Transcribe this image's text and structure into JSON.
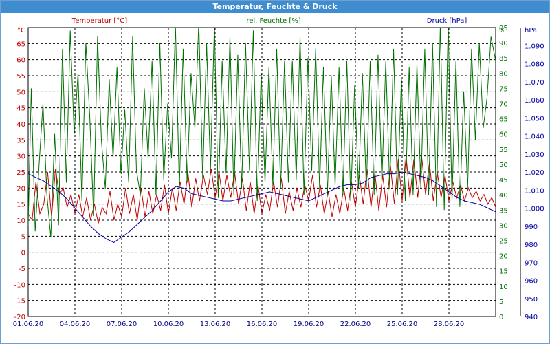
{
  "window": {
    "title": "Temperatur, Feuchte & Druck"
  },
  "colors": {
    "temperature": "#c00000",
    "humidity": "#007000",
    "pressure": "#0000a0",
    "axis_x": "#000080",
    "titlebar": "#3f8ccf"
  },
  "chart_data": {
    "type": "line",
    "title": "Temperatur, Feuchte & Druck",
    "grid": true,
    "x_ticks": [
      "01.06.20",
      "04.06.20",
      "07.06.20",
      "10.06.20",
      "13.06.20",
      "16.06.20",
      "19.06.20",
      "22.06.20",
      "25.06.20",
      "28.06.20"
    ],
    "x_range_days": [
      1,
      31
    ],
    "axes": {
      "left": {
        "label": "Temperatur [°C]",
        "unit": "°C",
        "range": [
          -20,
          70
        ],
        "ticks": [
          "65",
          "60",
          "55",
          "50",
          "45",
          "40",
          "35",
          "30",
          "25",
          "20",
          "15",
          "10",
          "5",
          "0",
          "-5",
          "-10",
          "-15",
          "-20"
        ]
      },
      "right1": {
        "label": "rel. Feuchte [%]",
        "unit": "%",
        "range": [
          0,
          95
        ],
        "ticks": [
          "95",
          "90",
          "85",
          "80",
          "75",
          "70",
          "65",
          "60",
          "55",
          "50",
          "45",
          "40",
          "35",
          "30",
          "25",
          "20",
          "15",
          "10",
          "5",
          "0"
        ]
      },
      "right2": {
        "label": "Druck [hPa]",
        "unit": "hPa",
        "range": [
          940,
          1100
        ],
        "ticks": [
          "1.090",
          "1.080",
          "1.070",
          "1.060",
          "1.050",
          "1.040",
          "1.030",
          "1.020",
          "1.010",
          "1.000",
          "990",
          "980",
          "970",
          "960",
          "950",
          "940"
        ]
      }
    },
    "series": [
      {
        "name": "Temperatur [°C]",
        "axis": "left",
        "x": [
          1.0,
          1.25,
          1.5,
          1.75,
          2.0,
          2.25,
          2.5,
          2.75,
          3.0,
          3.25,
          3.5,
          3.75,
          4.0,
          4.25,
          4.5,
          4.75,
          5.0,
          5.25,
          5.5,
          5.75,
          6.0,
          6.25,
          6.5,
          6.75,
          7.0,
          7.25,
          7.5,
          7.75,
          8.0,
          8.25,
          8.5,
          8.75,
          9.0,
          9.25,
          9.5,
          9.75,
          10.0,
          10.25,
          10.5,
          10.75,
          11.0,
          11.25,
          11.5,
          11.75,
          12.0,
          12.25,
          12.5,
          12.75,
          13.0,
          13.25,
          13.5,
          13.75,
          14.0,
          14.25,
          14.5,
          14.75,
          15.0,
          15.25,
          15.5,
          15.75,
          16.0,
          16.25,
          16.5,
          16.75,
          17.0,
          17.25,
          17.5,
          17.75,
          18.0,
          18.25,
          18.5,
          18.75,
          19.0,
          19.25,
          19.5,
          19.75,
          20.0,
          20.25,
          20.5,
          20.75,
          21.0,
          21.25,
          21.5,
          21.75,
          22.0,
          22.25,
          22.5,
          22.75,
          23.0,
          23.25,
          23.5,
          23.75,
          24.0,
          24.25,
          24.5,
          24.75,
          25.0,
          25.25,
          25.5,
          25.75,
          26.0,
          26.25,
          26.5,
          26.75,
          27.0,
          27.25,
          27.5,
          27.75,
          28.0,
          28.25,
          28.5,
          28.75,
          29.0,
          29.25,
          29.5,
          29.75,
          30.0,
          30.25,
          30.5,
          30.75,
          31.0
        ],
        "values": [
          12,
          10,
          22,
          12,
          15,
          25,
          11,
          26,
          18,
          20,
          14,
          18,
          12,
          18,
          11,
          17,
          10,
          15,
          9,
          14,
          12,
          19,
          10,
          15,
          11,
          20,
          12,
          18,
          10,
          20,
          11,
          19,
          12,
          18,
          13,
          21,
          12,
          20,
          13,
          22,
          15,
          25,
          14,
          23,
          16,
          24,
          18,
          26,
          17,
          25,
          16,
          24,
          17,
          25,
          15,
          23,
          13,
          22,
          12,
          21,
          12,
          18,
          13,
          22,
          14,
          23,
          12,
          19,
          13,
          20,
          14,
          21,
          16,
          24,
          14,
          21,
          12,
          19,
          11,
          18,
          12,
          20,
          13,
          22,
          14,
          24,
          15,
          26,
          14,
          25,
          13,
          24,
          14,
          27,
          15,
          29,
          16,
          30,
          17,
          29,
          17,
          30,
          18,
          28,
          16,
          25,
          17,
          24,
          16,
          22,
          17,
          21,
          16,
          20,
          17,
          19,
          16,
          18,
          15,
          17,
          14
        ],
        "color": "#c00000"
      },
      {
        "name": "rel. Feuchte [%]",
        "axis": "right1",
        "x": [
          1.0,
          1.2,
          1.45,
          1.7,
          1.95,
          2.2,
          2.45,
          2.7,
          2.95,
          3.2,
          3.45,
          3.7,
          3.95,
          4.2,
          4.45,
          4.7,
          4.95,
          5.2,
          5.45,
          5.7,
          5.95,
          6.2,
          6.45,
          6.7,
          6.95,
          7.2,
          7.45,
          7.7,
          7.95,
          8.2,
          8.45,
          8.7,
          8.95,
          9.2,
          9.45,
          9.7,
          9.95,
          10.2,
          10.45,
          10.7,
          10.95,
          11.2,
          11.45,
          11.7,
          11.95,
          12.2,
          12.45,
          12.7,
          12.95,
          13.2,
          13.45,
          13.7,
          13.95,
          14.2,
          14.45,
          14.7,
          14.95,
          15.2,
          15.45,
          15.7,
          15.95,
          16.2,
          16.45,
          16.7,
          16.95,
          17.2,
          17.45,
          17.7,
          17.95,
          18.2,
          18.45,
          18.7,
          18.95,
          19.2,
          19.45,
          19.7,
          19.95,
          20.2,
          20.45,
          20.7,
          20.95,
          21.2,
          21.45,
          21.7,
          21.95,
          22.2,
          22.45,
          22.7,
          22.95,
          23.2,
          23.45,
          23.7,
          23.95,
          24.2,
          24.45,
          24.7,
          24.95,
          25.2,
          25.45,
          25.7,
          25.95,
          26.2,
          26.45,
          26.7,
          26.95,
          27.2,
          27.45,
          27.7,
          27.95,
          28.2,
          28.45,
          28.7,
          28.95,
          29.2,
          29.45,
          29.7,
          29.95,
          30.2,
          30.45,
          30.7,
          31.0
        ],
        "values": [
          30,
          75,
          28,
          50,
          70,
          40,
          26,
          60,
          30,
          88,
          44,
          94,
          60,
          80,
          38,
          90,
          66,
          33,
          92,
          58,
          42,
          78,
          52,
          82,
          47,
          68,
          44,
          92,
          48,
          40,
          75,
          52,
          84,
          40,
          90,
          45,
          70,
          52,
          96,
          42,
          88,
          44,
          80,
          62,
          97,
          45,
          90,
          48,
          96,
          39,
          84,
          47,
          92,
          40,
          86,
          42,
          90,
          48,
          94,
          38,
          80,
          44,
          82,
          43,
          88,
          42,
          84,
          44,
          84,
          45,
          92,
          40,
          85,
          48,
          88,
          42,
          82,
          40,
          79,
          43,
          82,
          40,
          84,
          38,
          76,
          42,
          80,
          42,
          84,
          40,
          86,
          44,
          84,
          42,
          88,
          40,
          78,
          38,
          82,
          40,
          83,
          42,
          88,
          40,
          90,
          36,
          96,
          35,
          96,
          38,
          84,
          36,
          74,
          42,
          88,
          58,
          90,
          62,
          72,
          92,
          84
        ],
        "color": "#007000"
      },
      {
        "name": "Druck [hPa]",
        "axis": "right2",
        "x": [
          1.0,
          1.5,
          2.0,
          2.5,
          3.0,
          3.5,
          4.0,
          4.5,
          5.0,
          5.5,
          6.0,
          6.5,
          7.0,
          7.5,
          8.0,
          8.5,
          9.0,
          9.5,
          10.0,
          10.5,
          11.0,
          11.5,
          12.0,
          12.5,
          13.0,
          13.5,
          14.0,
          14.5,
          15.0,
          15.5,
          16.0,
          16.5,
          17.0,
          17.5,
          18.0,
          18.5,
          19.0,
          19.5,
          20.0,
          20.5,
          21.0,
          21.5,
          22.0,
          22.5,
          23.0,
          23.5,
          24.0,
          24.5,
          25.0,
          25.5,
          26.0,
          26.5,
          27.0,
          27.5,
          28.0,
          28.5,
          29.0,
          29.5,
          30.0,
          30.5,
          31.0
        ],
        "values": [
          1019,
          1017,
          1015,
          1012,
          1009,
          1005,
          1000,
          995,
          990,
          986,
          983,
          981,
          984,
          987,
          991,
          995,
          999,
          1004,
          1009,
          1012,
          1011,
          1008,
          1007,
          1006,
          1005,
          1004,
          1004,
          1005,
          1006,
          1007,
          1008,
          1009,
          1008,
          1007,
          1006,
          1005,
          1004,
          1006,
          1008,
          1010,
          1012,
          1013,
          1013,
          1014,
          1017,
          1018,
          1019,
          1019,
          1020,
          1019,
          1018,
          1017,
          1015,
          1012,
          1009,
          1006,
          1004,
          1003,
          1002,
          1000,
          998
        ],
        "color": "#0000a0"
      }
    ]
  }
}
